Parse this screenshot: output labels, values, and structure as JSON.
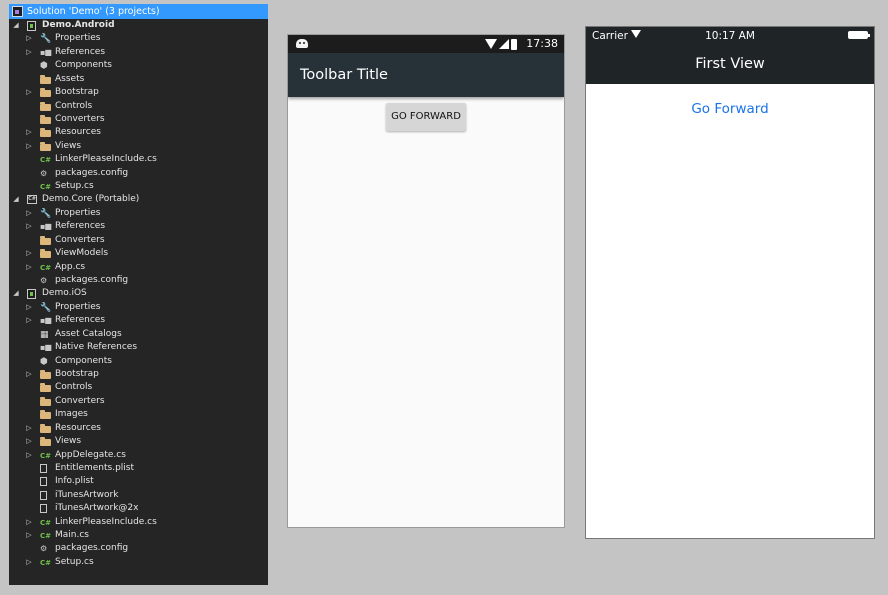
{
  "solution_explorer": {
    "header": "Solution 'Demo' (3 projects)",
    "items": [
      {
        "label": "Demo.Android",
        "level": 0,
        "icon": "project-icon",
        "expander": "expanded",
        "bold": true
      },
      {
        "label": "Properties",
        "level": 1,
        "icon": "wrench-icon",
        "expander": "collapsed"
      },
      {
        "label": "References",
        "level": 1,
        "icon": "references-icon",
        "expander": "collapsed"
      },
      {
        "label": "Components",
        "level": 1,
        "icon": "components-icon",
        "expander": ""
      },
      {
        "label": "Assets",
        "level": 1,
        "icon": "folder-icon",
        "expander": ""
      },
      {
        "label": "Bootstrap",
        "level": 1,
        "icon": "folder-icon",
        "expander": "collapsed"
      },
      {
        "label": "Controls",
        "level": 1,
        "icon": "folder-icon",
        "expander": ""
      },
      {
        "label": "Converters",
        "level": 1,
        "icon": "folder-icon",
        "expander": ""
      },
      {
        "label": "Resources",
        "level": 1,
        "icon": "folder-icon",
        "expander": "collapsed"
      },
      {
        "label": "Views",
        "level": 1,
        "icon": "folder-icon",
        "expander": "collapsed"
      },
      {
        "label": "LinkerPleaseInclude.cs",
        "level": 1,
        "icon": "csharp-file-icon",
        "expander": ""
      },
      {
        "label": "packages.config",
        "level": 1,
        "icon": "config-file-icon",
        "expander": ""
      },
      {
        "label": "Setup.cs",
        "level": 1,
        "icon": "csharp-file-icon",
        "expander": ""
      },
      {
        "label": "Demo.Core (Portable)",
        "level": 0,
        "icon": "csharp-project-icon",
        "expander": "expanded"
      },
      {
        "label": "Properties",
        "level": 1,
        "icon": "wrench-icon",
        "expander": "collapsed"
      },
      {
        "label": "References",
        "level": 1,
        "icon": "references-icon",
        "expander": "collapsed"
      },
      {
        "label": "Converters",
        "level": 1,
        "icon": "folder-icon",
        "expander": ""
      },
      {
        "label": "ViewModels",
        "level": 1,
        "icon": "folder-icon",
        "expander": "collapsed"
      },
      {
        "label": "App.cs",
        "level": 1,
        "icon": "csharp-file-icon",
        "expander": "collapsed"
      },
      {
        "label": "packages.config",
        "level": 1,
        "icon": "config-file-icon",
        "expander": ""
      },
      {
        "label": "Demo.iOS",
        "level": 0,
        "icon": "project-icon",
        "expander": "expanded"
      },
      {
        "label": "Properties",
        "level": 1,
        "icon": "wrench-icon",
        "expander": "collapsed"
      },
      {
        "label": "References",
        "level": 1,
        "icon": "references-icon",
        "expander": "collapsed"
      },
      {
        "label": "Asset Catalogs",
        "level": 1,
        "icon": "asset-catalog-icon",
        "expander": ""
      },
      {
        "label": "Native References",
        "level": 1,
        "icon": "references-icon",
        "expander": ""
      },
      {
        "label": "Components",
        "level": 1,
        "icon": "components-icon",
        "expander": ""
      },
      {
        "label": "Bootstrap",
        "level": 1,
        "icon": "folder-icon",
        "expander": "collapsed"
      },
      {
        "label": "Controls",
        "level": 1,
        "icon": "folder-icon",
        "expander": ""
      },
      {
        "label": "Converters",
        "level": 1,
        "icon": "folder-icon",
        "expander": ""
      },
      {
        "label": "Images",
        "level": 1,
        "icon": "folder-icon",
        "expander": ""
      },
      {
        "label": "Resources",
        "level": 1,
        "icon": "folder-icon",
        "expander": "collapsed"
      },
      {
        "label": "Views",
        "level": 1,
        "icon": "folder-icon",
        "expander": "collapsed"
      },
      {
        "label": "AppDelegate.cs",
        "level": 1,
        "icon": "csharp-file-icon",
        "expander": "collapsed"
      },
      {
        "label": "Entitlements.plist",
        "level": 1,
        "icon": "plist-file-icon",
        "expander": ""
      },
      {
        "label": "Info.plist",
        "level": 1,
        "icon": "plist-file-icon",
        "expander": ""
      },
      {
        "label": "iTunesArtwork",
        "level": 1,
        "icon": "file-icon",
        "expander": ""
      },
      {
        "label": "iTunesArtwork@2x",
        "level": 1,
        "icon": "file-icon",
        "expander": ""
      },
      {
        "label": "LinkerPleaseInclude.cs",
        "level": 1,
        "icon": "csharp-file-icon",
        "expander": "collapsed"
      },
      {
        "label": "Main.cs",
        "level": 1,
        "icon": "csharp-file-icon",
        "expander": "collapsed"
      },
      {
        "label": "packages.config",
        "level": 1,
        "icon": "config-file-icon",
        "expander": ""
      },
      {
        "label": "Setup.cs",
        "level": 1,
        "icon": "csharp-file-icon",
        "expander": "collapsed"
      }
    ]
  },
  "android": {
    "status_time": "17:38",
    "toolbar_title": "Toolbar Title",
    "button_label": "GO FORWARD"
  },
  "ios": {
    "carrier": "Carrier",
    "clock": "10:17 AM",
    "nav_title": "First View",
    "link_label": "Go Forward"
  },
  "colors": {
    "selection": "#3399ff",
    "explorer_bg": "#252526",
    "android_toolbar": "#263238",
    "ios_nav": "#1f2427",
    "ios_link": "#1a73e8"
  }
}
